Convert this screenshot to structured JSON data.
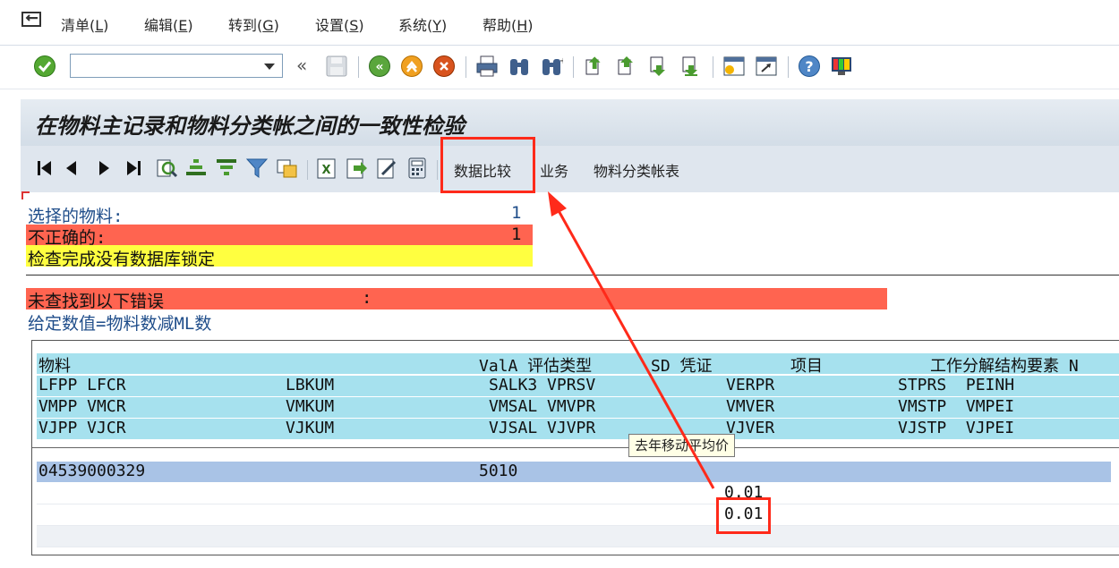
{
  "menu": {
    "items": [
      {
        "label": "清单(",
        "hotkey": "L",
        "end": ")"
      },
      {
        "label": "编辑(",
        "hotkey": "E",
        "end": ")"
      },
      {
        "label": "转到(",
        "hotkey": "G",
        "end": ")"
      },
      {
        "label": "设置(",
        "hotkey": "S",
        "end": ")"
      },
      {
        "label": "系统(",
        "hotkey": "Y",
        "end": ")"
      },
      {
        "label": "帮助(",
        "hotkey": "H",
        "end": ")"
      }
    ]
  },
  "toolbar": {
    "command_value": "",
    "icons": [
      "enter-check-icon",
      "command-dropdown-icon",
      "collapse-icon",
      "save-icon",
      "back-icon",
      "exit-icon",
      "cancel-icon",
      "print-icon",
      "find-icon",
      "find-next-icon",
      "first-page-icon",
      "previous-page-icon",
      "next-page-icon",
      "last-page-icon",
      "new-session-icon",
      "shortcut-icon",
      "help-icon",
      "layout-icon"
    ]
  },
  "title": "在物料主记录和物料分类帐之间的一致性检验",
  "app_toolbar": {
    "buttons": [
      "数据比较",
      "业务",
      "物料分类帐表"
    ]
  },
  "list": {
    "selected_label": "选择的物料:",
    "selected_value": "1",
    "incorrect_label": "不正确的:",
    "incorrect_value": "1",
    "check_done": "检查完成没有数据库锁定",
    "error_header": "未查找到以下错误",
    "error_colon": ":",
    "given_value": "给定数值=物料数减ML数"
  },
  "grid": {
    "header1": {
      "c1": "物料",
      "c2": "ValA 评估类型",
      "c3": "SD 凭证",
      "c4": "项目",
      "c5": "工作分解结构要素 N"
    },
    "header2": {
      "c1": "LFPP LFCR",
      "c2": "LBKUM",
      "c3": "SALK3 VPRSV",
      "c4": "VERPR",
      "c5": "STPRS  PEINH"
    },
    "header3": {
      "c1": "VMPP VMCR",
      "c2": "VMKUM",
      "c3": "VMSAL VMVPR",
      "c4": "VMVER",
      "c5": "VMSTP  VMPEI"
    },
    "header4": {
      "c1": "VJPP VJCR",
      "c2": "VJKUM",
      "c3": "VJSAL VJVPR",
      "c4": "VJVER",
      "c5": "VJSTP  VJPEI"
    },
    "row_material": "04539000329",
    "row_plant": "5010",
    "value1": "0.01",
    "value2": "0.01"
  },
  "tooltip": "去年移动平均价",
  "colors": {
    "error_red": "#ff6450",
    "warn_yellow": "#ffff40",
    "header_cyan": "#a6e1ee",
    "row_blue": "#a9c3e6",
    "annotation_red": "#ff2a1a"
  }
}
